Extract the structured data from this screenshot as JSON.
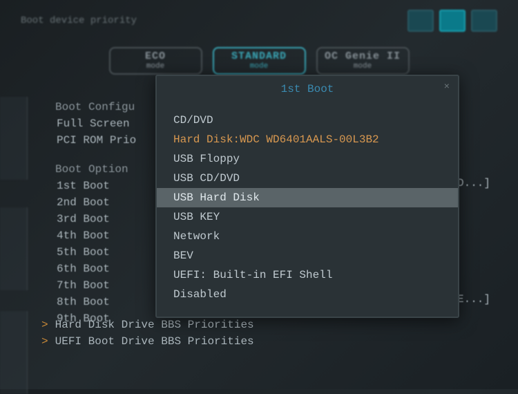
{
  "header": {
    "section_label": "Boot device priority"
  },
  "modes": {
    "eco": {
      "label": "ECO",
      "sub": "mode"
    },
    "standard": {
      "label": "STANDARD",
      "sub": "mode"
    },
    "ocgenie": {
      "label": "OC Genie II",
      "sub": "mode"
    }
  },
  "background": {
    "config_header": "Boot Configu",
    "full_screen": "Full Screen",
    "pci_rom": "PCI ROM Prio",
    "option_header": "Boot Option",
    "boots": {
      "b1": "1st Boot",
      "b2": "2nd Boot",
      "b3": "3rd Boot",
      "b4": "4th Boot",
      "b5": "5th Boot",
      "b6": "6th Boot",
      "b7": "7th Boot",
      "b8": "8th Boot",
      "b9": "9th Boot"
    },
    "val_right1": "D...]",
    "val_right2": "E...]"
  },
  "bbs": {
    "hd": "Hard Disk Drive BBS Priorities",
    "uefi": "UEFI Boot Drive BBS Priorities",
    "chevron": ">"
  },
  "dialog": {
    "title": "1st Boot",
    "close": "×",
    "items": {
      "i0": "CD/DVD",
      "i1": "Hard Disk:WDC WD6401AALS-00L3B2",
      "i2": "USB Floppy",
      "i3": "USB CD/DVD",
      "i4": "USB Hard Disk",
      "i5": "USB KEY",
      "i6": "Network",
      "i7": "BEV",
      "i8": "UEFI: Built-in EFI Shell",
      "i9": "Disabled"
    }
  }
}
